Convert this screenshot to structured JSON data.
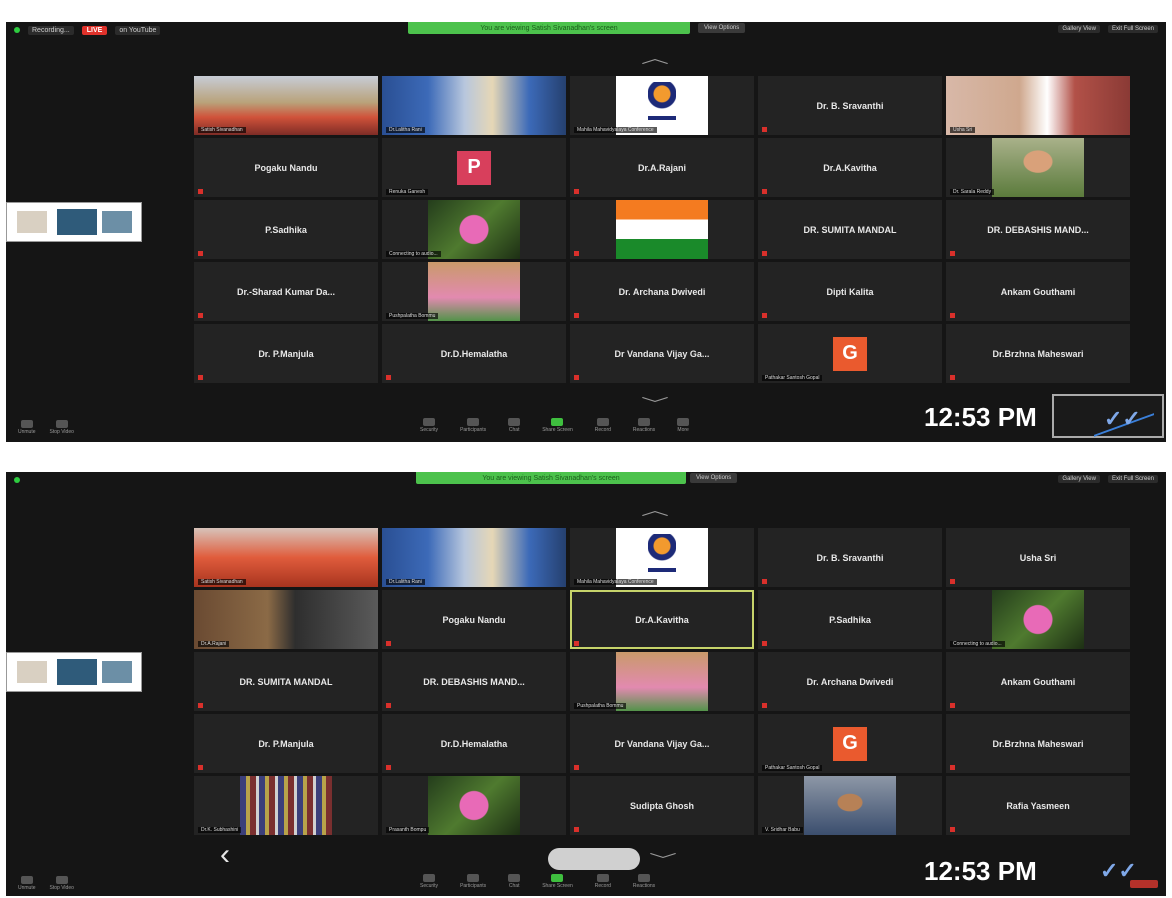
{
  "top": {
    "recording_label": "Recording...",
    "live_label": "LIVE",
    "live_platform": "on YouTube",
    "viewing_banner": "You are viewing Satish Sivanadhan's screen",
    "view_options": "View Options",
    "right_controls": [
      "Gallery View",
      "Exit Full Screen"
    ],
    "toolbar": {
      "left": [
        "Unmute",
        "Stop Video"
      ],
      "center": [
        "Security",
        "Participants",
        "Chat",
        "Share Screen",
        "Record",
        "Reactions",
        "More"
      ]
    },
    "time": "12:53 PM",
    "tiles": [
      {
        "name": "Satish Sivanadhan",
        "style": "cam-room"
      },
      {
        "name": "Dr.Lalitha Rani",
        "style": "cam-curtain"
      },
      {
        "name": "Mahila Mahavidyalaya Conference",
        "style": "cam-logo"
      },
      {
        "name": "Dr. B. Sravanthi",
        "style": "name"
      },
      {
        "name": "Usha Sri",
        "style": "cam-door",
        "active": true
      },
      {
        "name": "Pogaku Nandu",
        "style": "name"
      },
      {
        "name": "Renuka Ganesh",
        "style": "avatar",
        "letter": "P",
        "avatar": "av-p"
      },
      {
        "name": "Dr.A.Rajani",
        "style": "name"
      },
      {
        "name": "Dr.A.Kavitha",
        "style": "name"
      },
      {
        "name": "Dr. Sarala Reddy",
        "style": "cam-face"
      },
      {
        "name": "P.Sadhika",
        "style": "name"
      },
      {
        "name": "Connecting to audio...",
        "style": "cam-garden"
      },
      {
        "name": "",
        "style": "cam-flag"
      },
      {
        "name": "DR. SUMITA MANDAL",
        "style": "name"
      },
      {
        "name": "DR. DEBASHIS MAND...",
        "style": "name"
      },
      {
        "name": "Dr.-Sharad Kumar Da...",
        "style": "name"
      },
      {
        "name": "Pushpalatha Bommu",
        "style": "cam-green"
      },
      {
        "name": "Dr. Archana Dwivedi",
        "style": "name"
      },
      {
        "name": "Dipti Kalita",
        "style": "name"
      },
      {
        "name": "Ankam Gouthami",
        "style": "name"
      },
      {
        "name": "Dr. P.Manjula",
        "style": "name"
      },
      {
        "name": "Dr.D.Hemalatha",
        "style": "name"
      },
      {
        "name": "Dr Vandana Vijay Ga...",
        "style": "name"
      },
      {
        "name": "Pathakar Santosh Gopal",
        "style": "avatar",
        "letter": "G",
        "avatar": "av-g"
      },
      {
        "name": "Dr.Brzhna Maheswari",
        "style": "name"
      }
    ]
  },
  "bottom": {
    "viewing_banner": "You are viewing Satish Sivanadhan's screen",
    "view_options": "View Options",
    "right_controls": [
      "Gallery View",
      "Exit Full Screen"
    ],
    "toolbar": {
      "left": [
        "Unmute",
        "Stop Video"
      ],
      "center": [
        "Security",
        "Participants",
        "Chat",
        "Share Screen",
        "Record",
        "Reactions"
      ]
    },
    "time": "12:53 PM",
    "tiles": [
      {
        "name": "Satish Sivanadhan",
        "style": "cam-fabric"
      },
      {
        "name": "Dr.Lalitha Rani",
        "style": "cam-curtain"
      },
      {
        "name": "Mahila Mahavidyalaya Conference",
        "style": "cam-logo"
      },
      {
        "name": "Dr. B. Sravanthi",
        "style": "name"
      },
      {
        "name": "Usha Sri",
        "style": "name"
      },
      {
        "name": "Dr.A.Rajani",
        "style": "cam-desk"
      },
      {
        "name": "Pogaku Nandu",
        "style": "name"
      },
      {
        "name": "Dr.A.Kavitha",
        "style": "name",
        "active": true
      },
      {
        "name": "P.Sadhika",
        "style": "name"
      },
      {
        "name": "Connecting to audio...",
        "style": "cam-garden"
      },
      {
        "name": "DR. SUMITA MANDAL",
        "style": "name"
      },
      {
        "name": "DR. DEBASHIS MAND...",
        "style": "name"
      },
      {
        "name": "Pushpalatha Bommu",
        "style": "cam-green"
      },
      {
        "name": "Dr. Archana Dwivedi",
        "style": "name"
      },
      {
        "name": "Ankam Gouthami",
        "style": "name"
      },
      {
        "name": "Dr. P.Manjula",
        "style": "name"
      },
      {
        "name": "Dr.D.Hemalatha",
        "style": "name"
      },
      {
        "name": "Dr Vandana Vijay Ga...",
        "style": "name"
      },
      {
        "name": "Pathakar Santosh Gopal",
        "style": "avatar",
        "letter": "G",
        "avatar": "av-g"
      },
      {
        "name": "Dr.Brzhna Maheswari",
        "style": "name"
      },
      {
        "name": "Dr.K. Subhashini",
        "style": "cam-shelf"
      },
      {
        "name": "Prasanth Bompu",
        "style": "cam-garden"
      },
      {
        "name": "Sudipta Ghosh",
        "style": "name"
      },
      {
        "name": "V. Sridhar Babu",
        "style": "cam-person"
      },
      {
        "name": "Rafia Yasmeen",
        "style": "name"
      }
    ]
  },
  "colors": {
    "background": "#151515",
    "tile": "#232323",
    "banner": "#4cc24c",
    "live": "#e0322b",
    "active_outline": "#c6d36a"
  },
  "icons": [
    "chevron-up-icon",
    "chevron-down-icon",
    "back-arrow-icon",
    "home-pill-icon",
    "double-check-icon",
    "mic-muted-icon"
  ]
}
